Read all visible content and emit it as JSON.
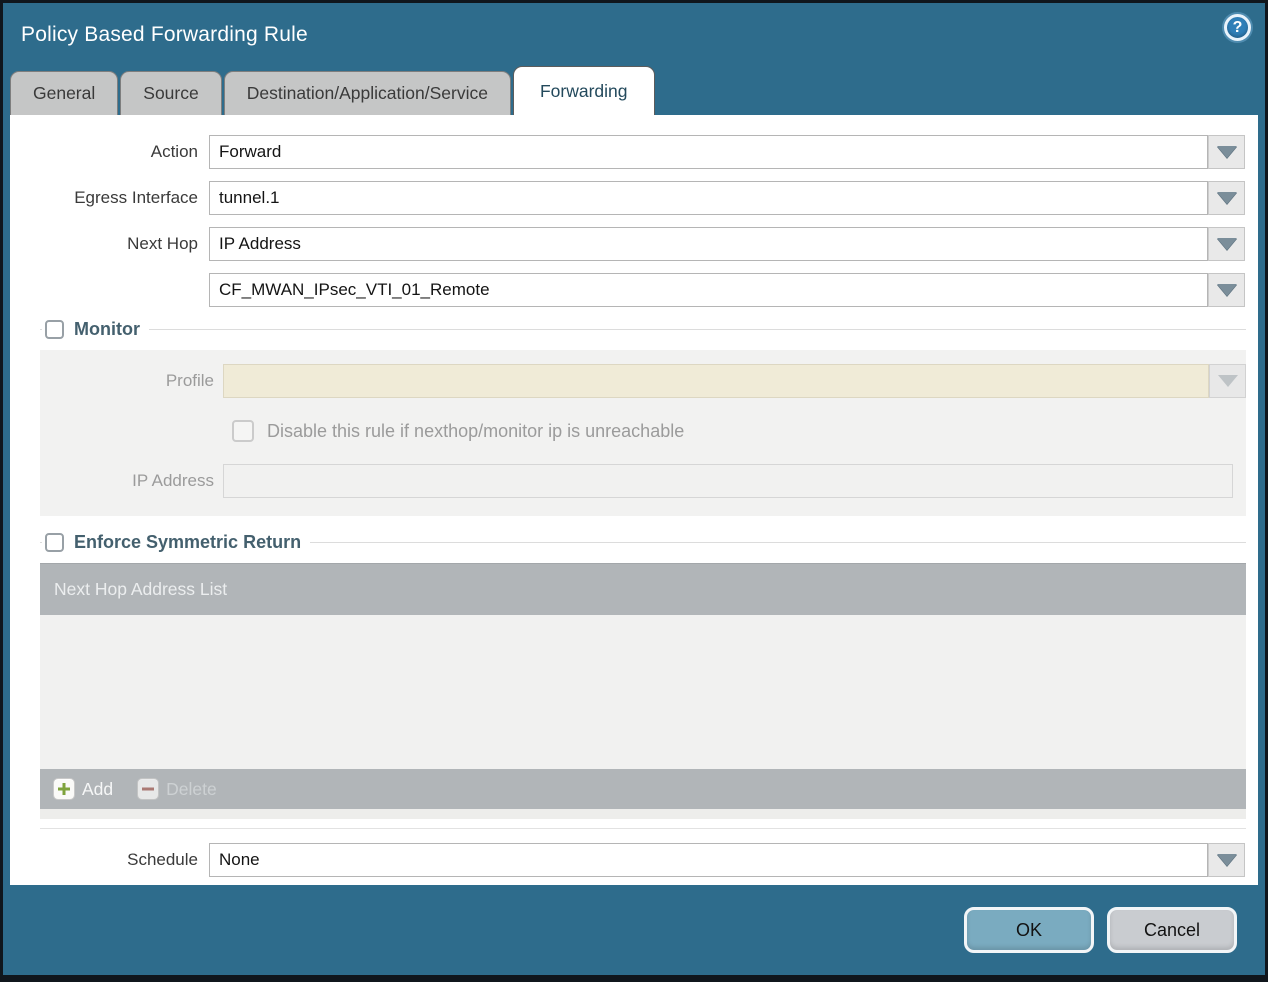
{
  "window": {
    "title": "Policy Based Forwarding Rule"
  },
  "tabs": [
    {
      "label": "General",
      "active": false
    },
    {
      "label": "Source",
      "active": false
    },
    {
      "label": "Destination/Application/Service",
      "active": false
    },
    {
      "label": "Forwarding",
      "active": true
    }
  ],
  "form": {
    "action": {
      "label": "Action",
      "value": "Forward"
    },
    "egress_interface": {
      "label": "Egress Interface",
      "value": "tunnel.1"
    },
    "next_hop": {
      "label": "Next Hop",
      "value": "IP Address"
    },
    "next_hop_address": {
      "value": "CF_MWAN_IPsec_VTI_01_Remote"
    },
    "schedule": {
      "label": "Schedule",
      "value": "None"
    }
  },
  "monitor": {
    "legend": "Monitor",
    "checked": false,
    "profile": {
      "label": "Profile",
      "value": ""
    },
    "disable_rule": {
      "label": "Disable this rule if nexthop/monitor ip is unreachable",
      "checked": false
    },
    "ip_address": {
      "label": "IP Address",
      "value": ""
    }
  },
  "symmetric_return": {
    "legend": "Enforce Symmetric Return",
    "checked": false,
    "table": {
      "header": "Next Hop Address List",
      "rows": []
    },
    "add_label": "Add",
    "delete_label": "Delete"
  },
  "footer": {
    "ok_label": "OK",
    "cancel_label": "Cancel"
  },
  "colors": {
    "titlebar": "#2e6c8c",
    "active_tab_text": "#23495c",
    "inactive_tab_bg": "#c5c6c6",
    "legend_text": "#44606e",
    "profile_field_bg": "#f0ebd7",
    "table_bar_bg": "#b1b5b8",
    "add_plus": "#7fa33c",
    "delete_minus": "#a8665c",
    "ok_button_bg": "#7aabc0",
    "cancel_button_bg": "#c9ccd0"
  }
}
